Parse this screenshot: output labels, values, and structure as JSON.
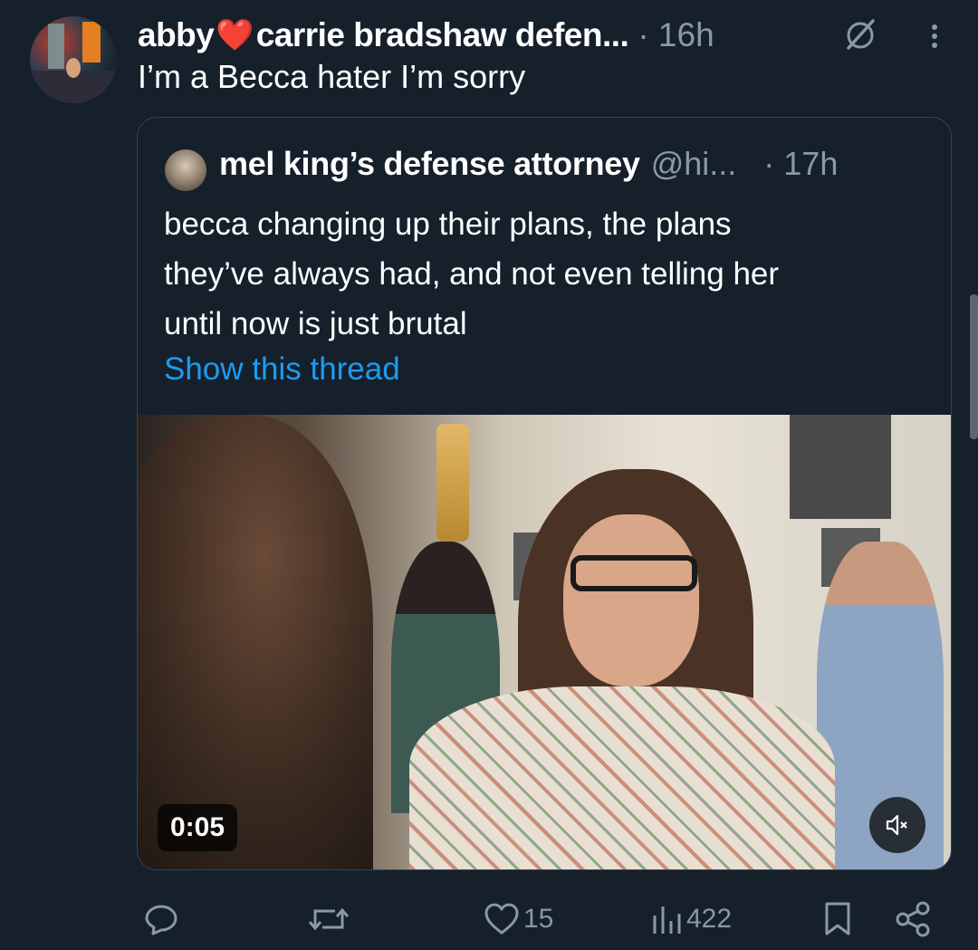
{
  "post": {
    "display_name": "abby",
    "heart": "❤️",
    "display_name_rest": "carrie bradshaw defen...",
    "time": "· 16h",
    "text": "I’m a Becca hater I’m sorry"
  },
  "quoted": {
    "display_name": "mel king’s defense attorney",
    "handle": "@hi...",
    "time": "· 17h",
    "text_lines": [
      "becca changing up their plans, the plans",
      "they’ve always had, and not even telling her",
      "until now is just brutal"
    ],
    "show_thread": "Show this thread",
    "video": {
      "timer": "0:05",
      "muted_icon": "speaker-muted-icon"
    }
  },
  "actions": {
    "reply_count": "",
    "repost_count": "",
    "like_count": "15",
    "views_count": "422"
  },
  "colors": {
    "background": "#15202b",
    "muted_text": "#8b98a5",
    "link": "#1d9bf0",
    "border": "#38444d",
    "heart": "#e0245e"
  }
}
